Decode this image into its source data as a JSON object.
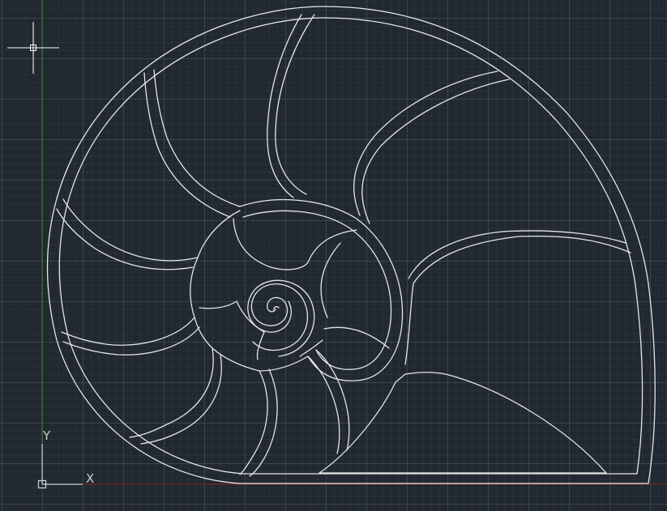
{
  "viewport": {
    "background_color": "#212830",
    "grid_color": "#3a4450",
    "drawing_color": "#e8e8e8",
    "axis_x_color": "#8a2a2a",
    "axis_y_color": "#2a7a2a"
  },
  "drawing": {
    "object": "nautilus-shell-outline"
  },
  "crosshair": {
    "icon": "crosshair-cursor-icon"
  },
  "ucs": {
    "icon": "ucs-axis-icon",
    "x_label": "X",
    "y_label": "Y"
  }
}
